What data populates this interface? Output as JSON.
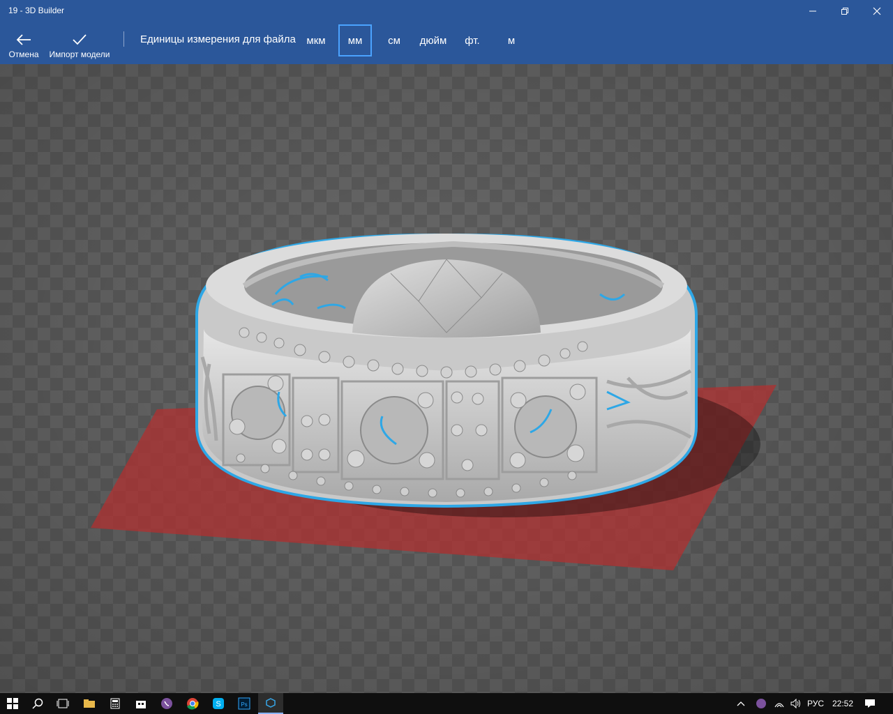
{
  "window": {
    "title": "19 - 3D Builder"
  },
  "toolbar": {
    "cancel_label": "Отмена",
    "import_label": "Импорт модели",
    "units_label": "Единицы измерения для файла",
    "units": [
      "мкм",
      "мм",
      "см",
      "дюйм",
      "фт.",
      "м"
    ],
    "selected_unit": "мм"
  },
  "taskbar": {
    "apps": [
      "start-icon",
      "search-icon",
      "task-view-icon",
      "file-explorer-icon",
      "calculator-icon",
      "store-icon",
      "viber-icon",
      "chrome-icon",
      "skype-icon",
      "photoshop-icon",
      "3d-builder-icon"
    ],
    "tray": {
      "language": "РУС",
      "time": "22:52"
    }
  },
  "colors": {
    "accent": "#2b579a",
    "selection": "#2ea7e6",
    "ground_plate": "#b03030"
  }
}
